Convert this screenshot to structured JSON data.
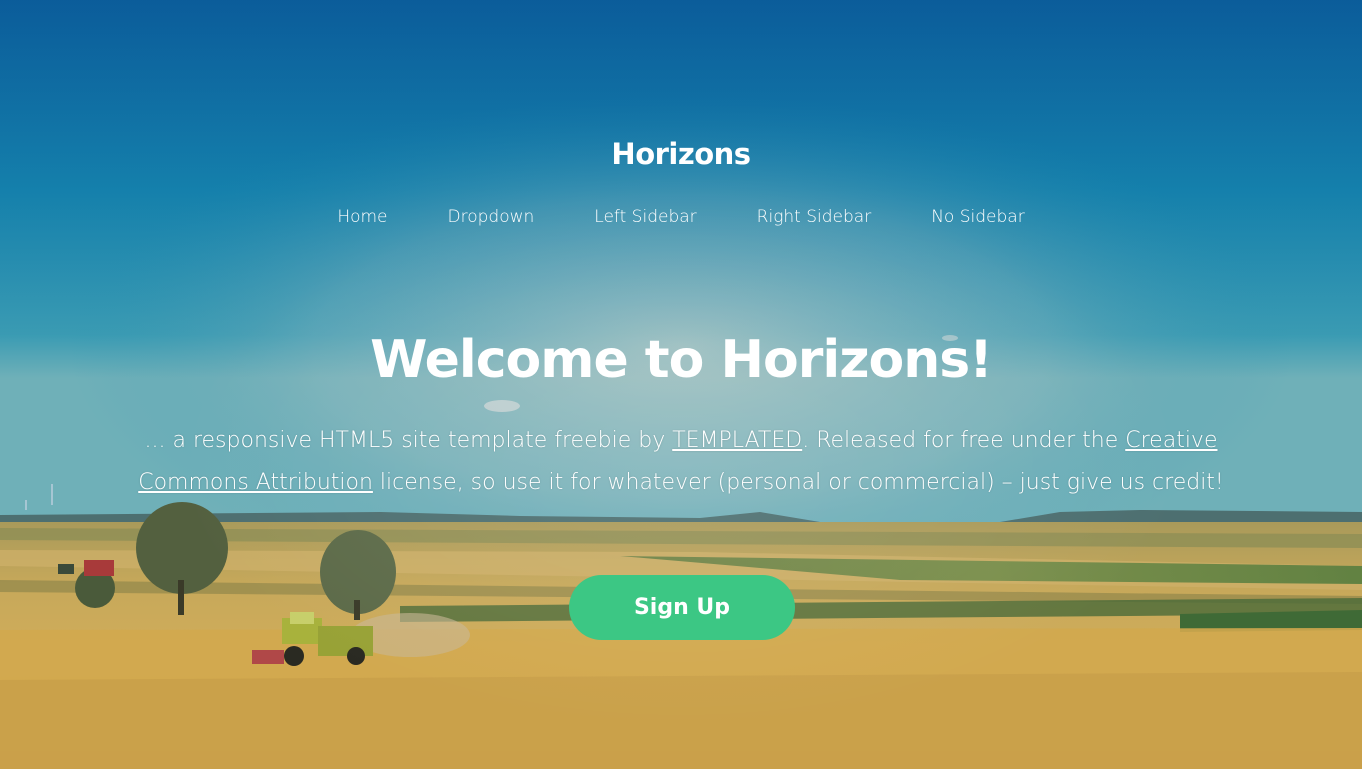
{
  "site": {
    "logo": "Horizons"
  },
  "nav": {
    "items": [
      {
        "label": "Home"
      },
      {
        "label": "Dropdown"
      },
      {
        "label": "Left Sidebar"
      },
      {
        "label": "Right Sidebar"
      },
      {
        "label": "No Sidebar"
      }
    ]
  },
  "banner": {
    "title": "Welcome to Horizons!",
    "text_part1": "... a responsive HTML5 site template freebie by ",
    "link_templated": "TEMPLATED",
    "text_part2": ". Released for free under the ",
    "link_license": "Creative Commons Attribution",
    "text_part3": " license, so use it for whatever (personal or commercial) – just give us credit!",
    "button_label": "Sign Up"
  },
  "colors": {
    "sky_top": "#0b5e9c",
    "sky_mid": "#1a8fae",
    "field": "#c9a24a",
    "button": "#3cc784",
    "text": "#ffffff"
  },
  "icons": {
    "background": "farm-field-tractor-image"
  }
}
